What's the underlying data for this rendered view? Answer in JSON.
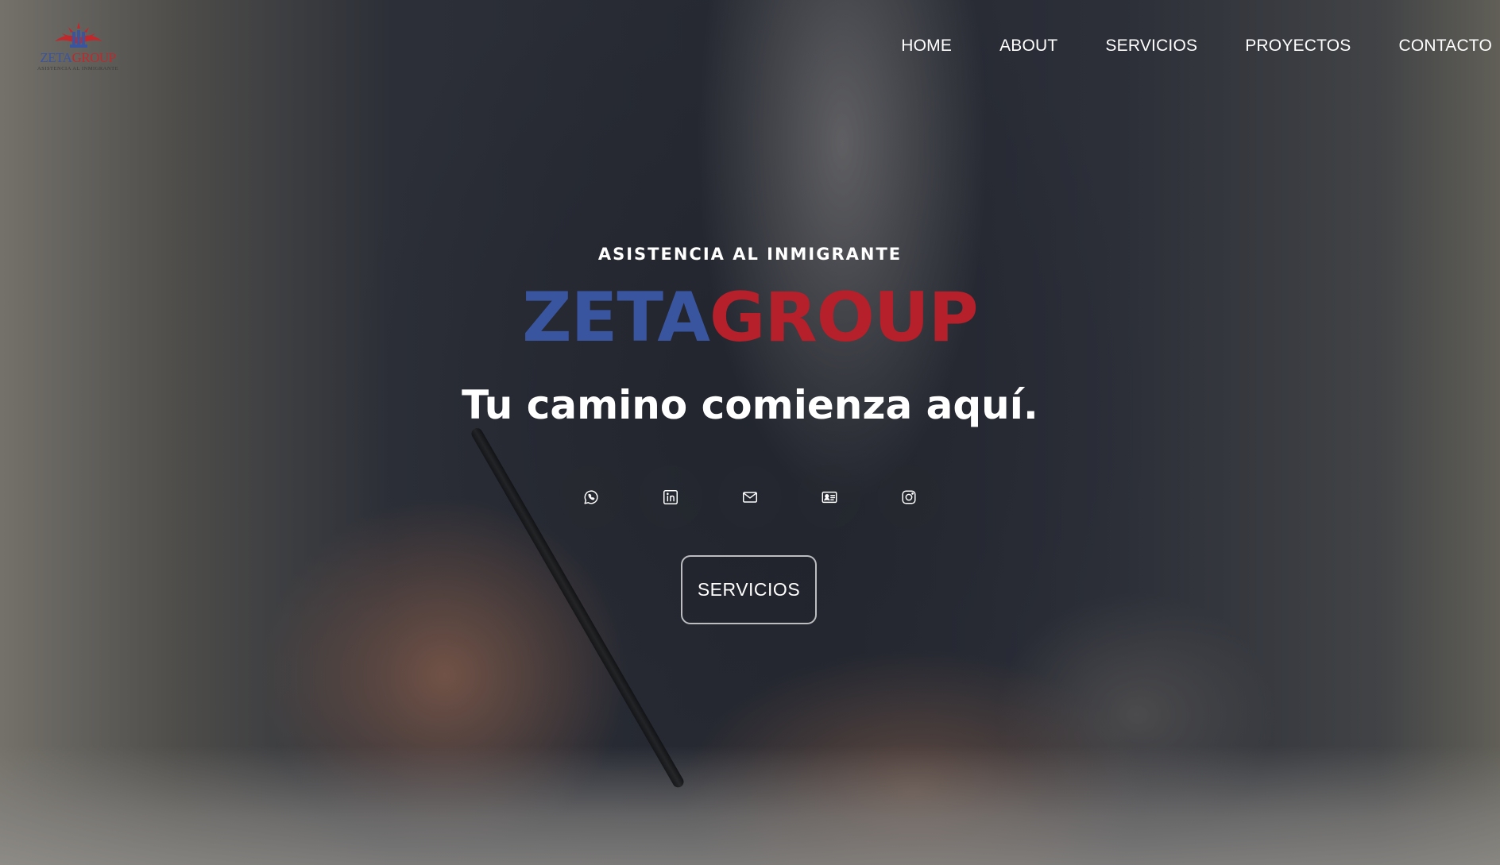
{
  "header": {
    "logo": {
      "word_zeta": "ZETA",
      "word_group": "GROUP",
      "subtitle": "ASISTENCIA AL INMIGRANTE"
    },
    "nav": [
      {
        "label": "HOME"
      },
      {
        "label": "ABOUT"
      },
      {
        "label": "SERVICIOS"
      },
      {
        "label": "PROYECTOS"
      },
      {
        "label": "CONTACTO"
      }
    ]
  },
  "hero": {
    "kicker": "ASISTENCIA AL INMIGRANTE",
    "brand_zeta": "ZETA",
    "brand_group": "GROUP",
    "tagline": "Tu camino comienza aquí.",
    "socials": [
      {
        "icon": "whatsapp-icon"
      },
      {
        "icon": "linkedin-icon"
      },
      {
        "icon": "mail-icon"
      },
      {
        "icon": "contact-card-icon"
      },
      {
        "icon": "instagram-icon"
      }
    ],
    "cta_label": "SERVICIOS"
  },
  "colors": {
    "brand_blue": "#3a55a0",
    "brand_red": "#b5202a",
    "text": "#ffffff"
  }
}
